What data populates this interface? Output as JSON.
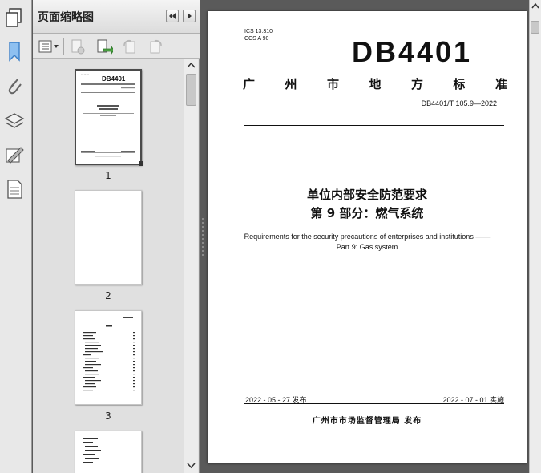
{
  "panel": {
    "title": "页面缩略图",
    "pages": [
      {
        "label": "1",
        "selected": true
      },
      {
        "label": "2",
        "selected": false
      },
      {
        "label": "3",
        "selected": false
      }
    ]
  },
  "document": {
    "ics": "ICS 13.310",
    "ccs": "CCS A 90",
    "code": "DB4401",
    "standard_chars": [
      "广",
      "州",
      "市",
      "地",
      "方",
      "标",
      "准"
    ],
    "number": "DB4401/T 105.9—2022",
    "title_cn_1": "单位内部安全防范要求",
    "title_cn_2": "第 9 部分：燃气系统",
    "title_en_1": "Requirements for the security precautions of enterprises and institutions ——",
    "title_en_2": "Part 9: Gas system",
    "issue_date": "2022 - 05 - 27 发布",
    "impl_date": "2022 - 07 - 01 实施",
    "publisher": "广州市市场监督管理局    发布"
  },
  "colors": {
    "viewer_background": "#5a5a5a",
    "panel_background": "#e2e2e2",
    "accent_icon": "#3a7fc8"
  }
}
